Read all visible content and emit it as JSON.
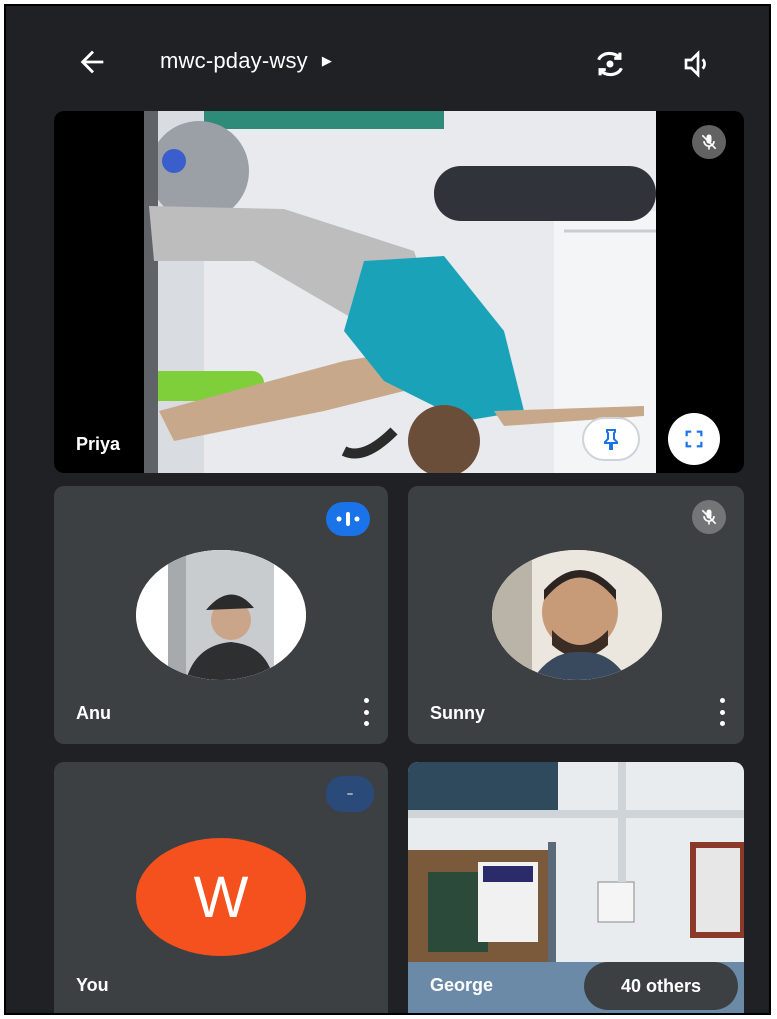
{
  "header": {
    "meeting_code": "mwc-pday-wsy"
  },
  "participants": {
    "main": {
      "name": "Priya",
      "muted": true
    },
    "tile1": {
      "name": "Anu",
      "speaking": true
    },
    "tile2": {
      "name": "Sunny",
      "muted": true
    },
    "tile3": {
      "name": "You",
      "avatar_letter": "W"
    },
    "tile4": {
      "name": "George",
      "others_label": "40 others"
    }
  },
  "colors": {
    "background": "#202124",
    "tile": "#3c4043",
    "accent_blue": "#1a73e8",
    "avatar_orange": "#f4511e"
  }
}
